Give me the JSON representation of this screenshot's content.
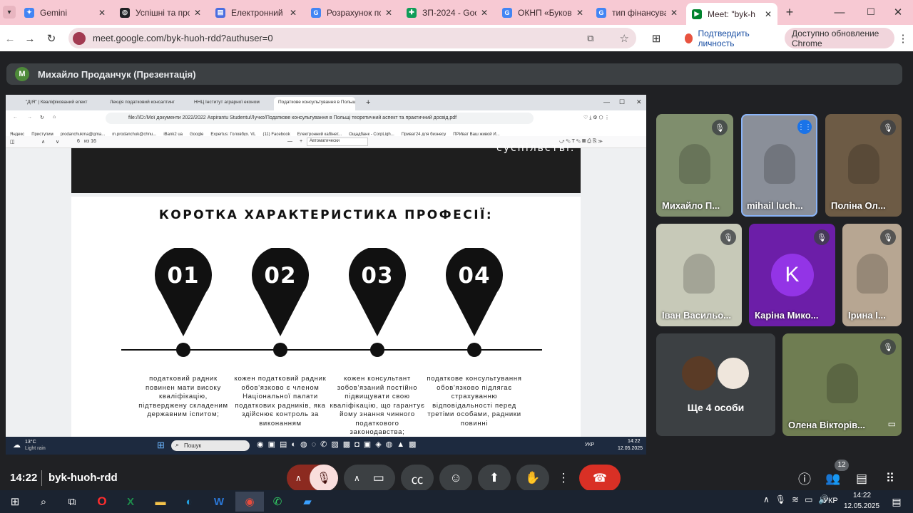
{
  "browser": {
    "tabs": [
      {
        "title": "Gemini",
        "color": "#4285f4",
        "glyph": "✦"
      },
      {
        "title": "Успішні та пров",
        "color": "#202124",
        "glyph": "◎"
      },
      {
        "title": "Електронний ка",
        "color": "#4a6ee0",
        "glyph": "▤"
      },
      {
        "title": "Розрахунок пок",
        "color": "#4285f4",
        "glyph": "G"
      },
      {
        "title": "ЗП-2024 - Goog",
        "color": "#0f9d58",
        "glyph": "✚"
      },
      {
        "title": "ОКНП «Буковин",
        "color": "#4285f4",
        "glyph": "G"
      },
      {
        "title": "тип фінансуван",
        "color": "#4285f4",
        "glyph": "G"
      },
      {
        "title": "Meet: \"byk-h",
        "color": "#00832d",
        "glyph": "▶"
      }
    ],
    "url": "meet.google.com/byk-huoh-rdd?authuser=0",
    "verify_label": "Подтвердить личность",
    "update_label": "Доступно обновление Chrome"
  },
  "meet": {
    "presenter_initial": "M",
    "presenter_label": "Михайло Проданчук (Презентація)",
    "time": "14:22",
    "meeting_code": "byk-huoh-rdd",
    "participants_count": "12",
    "participants": [
      {
        "name": "Михайло П...",
        "kind": "video",
        "bg": "#7f8e6d"
      },
      {
        "name": "mihail luch...",
        "kind": "video",
        "bg": "#8a8f99"
      },
      {
        "name": "Поліна Ол...",
        "kind": "video",
        "bg": "#6d5b45"
      },
      {
        "name": "Іван Васильо...",
        "kind": "video",
        "bg": "#c7c9b8"
      },
      {
        "name": "Каріна Мико...",
        "kind": "avatar",
        "initial": "K",
        "bg": "#6c1ea8"
      },
      {
        "name": "Ірина І...",
        "kind": "video",
        "bg": "#b7a692"
      },
      {
        "name": "Олена Вікторів...",
        "kind": "video",
        "bg": "#6f7d52"
      }
    ],
    "others_label": "Ще 4 особи"
  },
  "shared_screen": {
    "tabs": [
      "\"ДІЯ\" | Кваліфікований елект",
      "Лекція податковий консалтинг",
      "ННЦ Інститут аграрної економ",
      "Податкове консультування в Польщі"
    ],
    "address": "file:///D:/Мої документи 2022/2022 Aspirantu Studentu/Лучко/Податкове консультування в Польщі теоретичний аспект та практичний досвід.pdf",
    "bookmarks": [
      "Яндекс",
      "Приступим",
      "prodanchukma@gma...",
      "m.prodanchuk@chnu...",
      "iBank2 ua",
      "Google",
      "Expertus: Головбух. VL",
      "(11) Facebook",
      "Електронний кабінет...",
      "Ощадбанк - CorpLigh...",
      "Приват24 для бизнесу",
      "ПРИват Ваш живой И..."
    ],
    "page_num": "6",
    "page_of": "из 16",
    "zoom": "Автоматически",
    "top_word": "суспільстві.",
    "slide_title": "КОРОТКА ХАРАКТЕРИСТИКА ПРОФЕСІЇ:",
    "items": [
      {
        "num": "01",
        "text": "податковий радник повинен мати високу кваліфікацію, підтверджену складеним державним іспитом;"
      },
      {
        "num": "02",
        "text": "кожен податковий радник обов'язково є членом Національної палати податкових радників, яка здійснює контроль за виконанням"
      },
      {
        "num": "03",
        "text": "кожен консультант зобов'язаний постійно підвищувати свою кваліфікацію, що гарантує йому знання чинного податкового законодавства;"
      },
      {
        "num": "04",
        "text": "податкове консультування обов'язково підлягає страхуванню відповідальності перед третіми особами, радники повинні"
      }
    ],
    "weather_temp": "13°C",
    "weather_desc": "Light rain",
    "search_placeholder": "Пошук",
    "lang": "УКР",
    "time": "14:22",
    "date": "12.05.2025"
  },
  "taskbar": {
    "lang": "УКР",
    "time": "14:22",
    "date": "12.05.2025"
  }
}
